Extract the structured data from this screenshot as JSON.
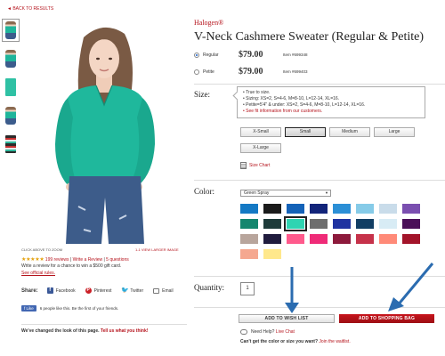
{
  "back_link": "◄ BACK TO RESULTS",
  "thumbnails": [
    {
      "type": "model"
    },
    {
      "type": "model"
    },
    {
      "type": "flat"
    },
    {
      "type": "model"
    },
    {
      "type": "stack"
    }
  ],
  "image_area": {
    "zoom_hint": "CLICK ABOVE TO ZOOM",
    "larger_link": "1-1 VIEW LARGER IMAGE"
  },
  "reviews": {
    "stars": "★★★★★",
    "count_link": "199 reviews",
    "divider": " | ",
    "write_link": "Write a Review",
    "questions_link": "5 questions",
    "promo": "Write a review for a chance to win a $500 gift card.",
    "official_rules": "See official rules."
  },
  "share": {
    "label": "Share:",
    "items": [
      {
        "name": "Facebook",
        "glyph": "f"
      },
      {
        "name": "Pinterest",
        "glyph": "P"
      },
      {
        "name": "Twitter",
        "glyph": "🐦"
      },
      {
        "name": "Email",
        "glyph": ""
      }
    ]
  },
  "like": {
    "button": "f Like",
    "text": "6 people like this. Be the first of your friends."
  },
  "changed_notice": {
    "text": "We've changed the look of this page.",
    "link": "Tell us what you think!"
  },
  "product": {
    "brand": "Halogen®",
    "title": "V-Neck Cashmere Sweater (Regular & Petite)"
  },
  "fits": [
    {
      "label": "Regular",
      "price": "$79.00",
      "item": "Item #699348",
      "selected": true
    },
    {
      "label": "Petite",
      "price": "$79.00",
      "item": "Item #699403",
      "selected": false
    }
  ],
  "size": {
    "label": "Size:",
    "info": [
      "True to size.",
      "Sizing: XS=2, S=4-6, M=8-10, L=12-14, XL=16.",
      "Petite=5'4\" & under: XS=2, S=4-6, M=8-10, L=12-14, XL=16."
    ],
    "fit_link": "See fit information from our customers.",
    "options": [
      "X-Small",
      "Small",
      "Medium",
      "Large",
      "X-Large"
    ],
    "selected": "Small",
    "chart_link": "Size Chart"
  },
  "color": {
    "label": "Color:",
    "selected_name": "Green Spray",
    "swatches": [
      "#1479c4",
      "#1b1b1b",
      "#1462b8",
      "#12247a",
      "#2b8fd6",
      "#86cbe8",
      "#c9dcea",
      "#7a4fb0",
      "#14866e",
      "#1e3b3a",
      "#2fd4b2",
      "#6e6e6e",
      "#1f33a0",
      "#123e64",
      "#d8ecf5",
      "#4a1058",
      "#b8a59c",
      "#201c3e",
      "#ff5a8c",
      "#ef2b78",
      "#8d1a3c",
      "#c6324a",
      "#ff8a78",
      "#a3142a",
      "#f5a890",
      "#ffe88c"
    ],
    "selected_index": 10
  },
  "quantity": {
    "label": "Quantity:",
    "value": "1"
  },
  "actions": {
    "wish_list": "ADD TO WISH LIST",
    "shopping_bag": "ADD TO SHOPPING BAG"
  },
  "help": {
    "text": "Need Help?",
    "link": "Live Chat"
  },
  "cant_get": {
    "text": "Can't get the color or size you want?",
    "link": "Join the waitlist."
  },
  "colors": {
    "accent": "#b5121b",
    "sweater": "#1fb89c",
    "arrow": "#2b6cb0"
  }
}
